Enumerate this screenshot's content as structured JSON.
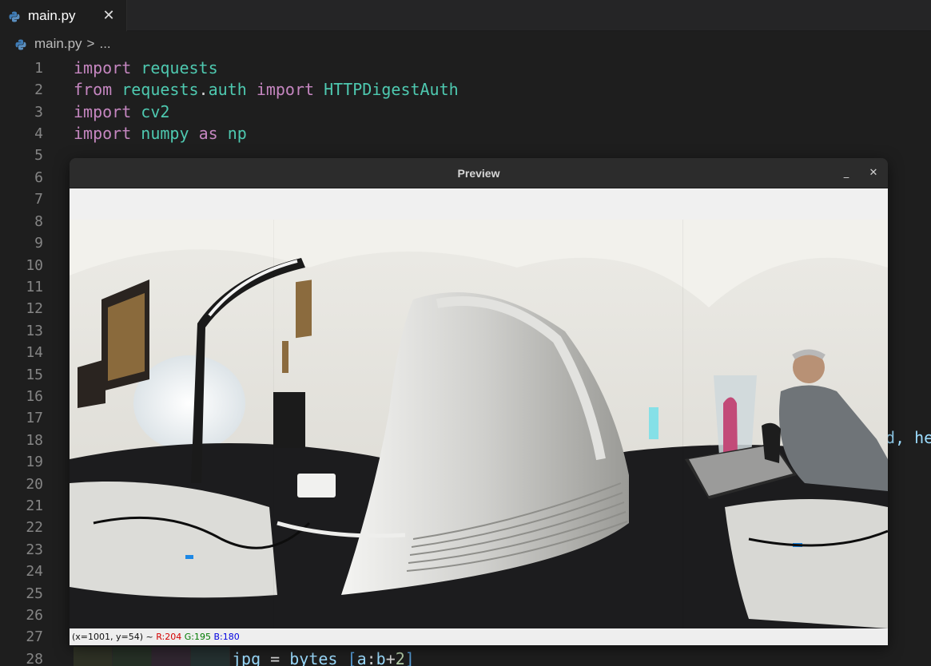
{
  "tab": {
    "label": "main.py",
    "close": "✕",
    "icon": "python-icon"
  },
  "breadcrumb": {
    "file": "main.py",
    "separator": ">",
    "more": "..."
  },
  "gutter": [
    "1",
    "2",
    "3",
    "4",
    "5",
    "6",
    "7",
    "8",
    "9",
    "10",
    "11",
    "12",
    "13",
    "14",
    "15",
    "16",
    "17",
    "18",
    "19",
    "20",
    "21",
    "22",
    "23",
    "24",
    "25",
    "26",
    "27",
    "28"
  ],
  "code": {
    "line1": {
      "kw": "import",
      "mod": "requests"
    },
    "line2": {
      "kw1": "from",
      "mod1": "requests",
      "dot": ".",
      "mod2": "auth",
      "kw2": "import",
      "cls": "HTTPDigestAuth"
    },
    "line3": {
      "kw": "import",
      "mod": "cv2"
    },
    "line4": {
      "kw1": "import",
      "mod": "numpy",
      "kw2": "as",
      "alias": "np"
    },
    "line18_partial": "d, he",
    "line28": {
      "var1": "jpg",
      "eq": "=",
      "var2": "bytes_",
      "open": "[",
      "a": "a",
      "colon": ":",
      "b": "b",
      "plus": "+",
      "two": "2",
      "close": "]"
    }
  },
  "preview": {
    "title": "Preview",
    "minimize": "_",
    "close": "✕",
    "status": {
      "coords": "(x=1001, y=54) ~",
      "r": "R:204",
      "g": "G:195",
      "b": "B:180"
    }
  },
  "colors": {
    "editor_bg": "#1e1e1e",
    "keyword": "#c586c0",
    "module": "#4ec9b0",
    "line_number": "#858585",
    "status_red": "#d40000",
    "status_green": "#007a00",
    "status_blue": "#0000e0"
  }
}
